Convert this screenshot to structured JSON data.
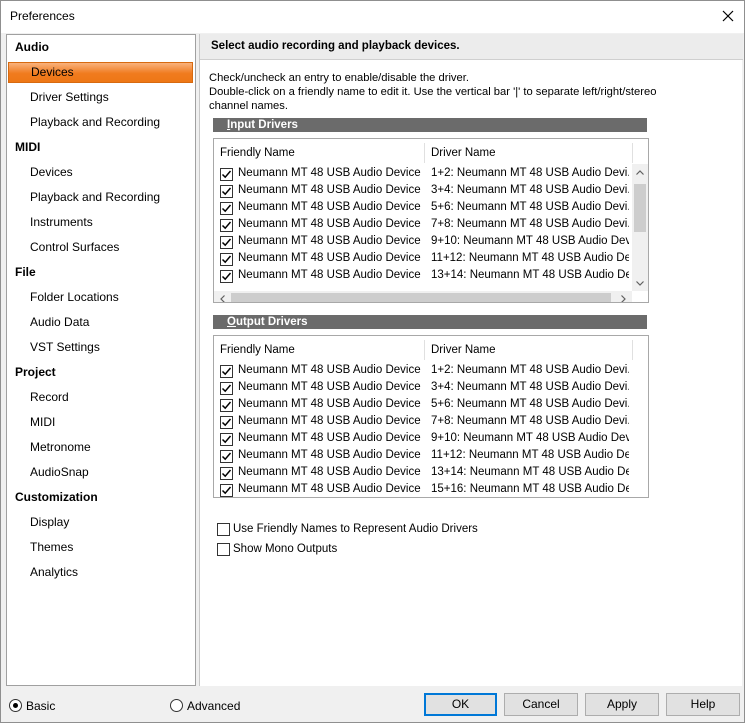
{
  "window": {
    "title": "Preferences"
  },
  "sidebar": {
    "sections": [
      {
        "label": "Audio",
        "items": [
          "Devices",
          "Driver Settings",
          "Playback and Recording"
        ]
      },
      {
        "label": "MIDI",
        "items": [
          "Devices",
          "Playback and Recording",
          "Instruments",
          "Control Surfaces"
        ]
      },
      {
        "label": "File",
        "items": [
          "Folder Locations",
          "Audio Data",
          "VST Settings"
        ]
      },
      {
        "label": "Project",
        "items": [
          "Record",
          "MIDI",
          "Metronome",
          "AudioSnap"
        ]
      },
      {
        "label": "Customization",
        "items": [
          "Display",
          "Themes",
          "Analytics"
        ]
      }
    ],
    "selected": "Audio/Devices"
  },
  "content": {
    "header": "Select audio recording and playback devices.",
    "instructions": [
      "Check/uncheck an entry to enable/disable the driver.",
      "Double-click on a friendly name to edit it. Use the vertical bar '|' to separate left/right/stereo",
      "channel names."
    ],
    "input_drivers": {
      "group_label_u": "I",
      "group_label_rest": "nput Drivers",
      "columns": [
        "Friendly Name",
        "Driver Name"
      ],
      "rows": [
        {
          "checked": true,
          "friendly": "Neumann MT 48 USB Audio Device ...",
          "driver": "1+2: Neumann MT 48 USB Audio Devi..."
        },
        {
          "checked": true,
          "friendly": "Neumann MT 48 USB Audio Device ...",
          "driver": "3+4: Neumann MT 48 USB Audio Devi..."
        },
        {
          "checked": true,
          "friendly": "Neumann MT 48 USB Audio Device ...",
          "driver": "5+6: Neumann MT 48 USB Audio Devi..."
        },
        {
          "checked": true,
          "friendly": "Neumann MT 48 USB Audio Device ...",
          "driver": "7+8: Neumann MT 48 USB Audio Devi..."
        },
        {
          "checked": true,
          "friendly": "Neumann MT 48 USB Audio Device ...",
          "driver": "9+10: Neumann MT 48 USB Audio Dev..."
        },
        {
          "checked": true,
          "friendly": "Neumann MT 48 USB Audio Device ...",
          "driver": "11+12: Neumann MT 48 USB Audio De..."
        },
        {
          "checked": true,
          "friendly": "Neumann MT 48 USB Audio Device ...",
          "driver": "13+14: Neumann MT 48 USB Audio De..."
        }
      ]
    },
    "output_drivers": {
      "group_label_u": "O",
      "group_label_rest": "utput Drivers",
      "columns": [
        "Friendly Name",
        "Driver Name"
      ],
      "rows": [
        {
          "checked": true,
          "friendly": "Neumann MT 48 USB Audio Device ...",
          "driver": "1+2: Neumann MT 48 USB Audio Devi..."
        },
        {
          "checked": true,
          "friendly": "Neumann MT 48 USB Audio Device ...",
          "driver": "3+4: Neumann MT 48 USB Audio Devi..."
        },
        {
          "checked": true,
          "friendly": "Neumann MT 48 USB Audio Device ...",
          "driver": "5+6: Neumann MT 48 USB Audio Devi..."
        },
        {
          "checked": true,
          "friendly": "Neumann MT 48 USB Audio Device ...",
          "driver": "7+8: Neumann MT 48 USB Audio Devi..."
        },
        {
          "checked": true,
          "friendly": "Neumann MT 48 USB Audio Device ...",
          "driver": "9+10: Neumann MT 48 USB Audio Dev..."
        },
        {
          "checked": true,
          "friendly": "Neumann MT 48 USB Audio Device ...",
          "driver": "11+12: Neumann MT 48 USB Audio De..."
        },
        {
          "checked": true,
          "friendly": "Neumann MT 48 USB Audio Device ...",
          "driver": "13+14: Neumann MT 48 USB Audio De..."
        },
        {
          "checked": true,
          "friendly": "Neumann MT 48 USB Audio Device ...",
          "driver": "15+16: Neumann MT 48 USB Audio De..."
        }
      ]
    },
    "options": [
      {
        "label": "Use Friendly Names to Represent Audio Drivers",
        "checked": false
      },
      {
        "label": "Show Mono Outputs",
        "checked": false
      }
    ]
  },
  "footer": {
    "mode_basic": "Basic",
    "mode_advanced": "Advanced",
    "mode_selected": "Basic",
    "ok": "OK",
    "cancel": "Cancel",
    "apply": "Apply",
    "help": "Help"
  },
  "icons": {
    "close": "close-icon",
    "check": "checkmark-icon",
    "scroll_up": "chevron-up-icon",
    "scroll_down": "chevron-down-icon",
    "scroll_left": "chevron-left-icon",
    "scroll_right": "chevron-right-icon"
  },
  "colors": {
    "selected_gradient_top": "#f9b27d",
    "selected_gradient_bottom": "#ee7716",
    "group_bar": "#6b6b6b",
    "default_button_border": "#0078d7"
  }
}
